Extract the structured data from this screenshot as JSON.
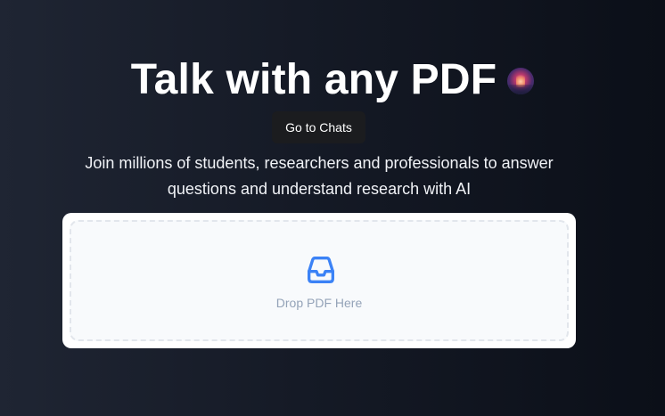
{
  "hero": {
    "title": "Talk with any PDF",
    "cta_label": "Go to Chats",
    "subtitle": "Join millions of students, researchers and professionals to answer questions and understand research with AI"
  },
  "upload": {
    "drop_label": "Drop PDF Here",
    "icon": "inbox-icon",
    "accent_color": "#3b82f6"
  },
  "colors": {
    "background_start": "#1f2533",
    "background_end": "#0b0f18",
    "button_bg": "#1b1c1f",
    "card_bg": "#ffffff",
    "dropzone_bg": "#f8fafc",
    "label_color": "#94a3b8"
  }
}
